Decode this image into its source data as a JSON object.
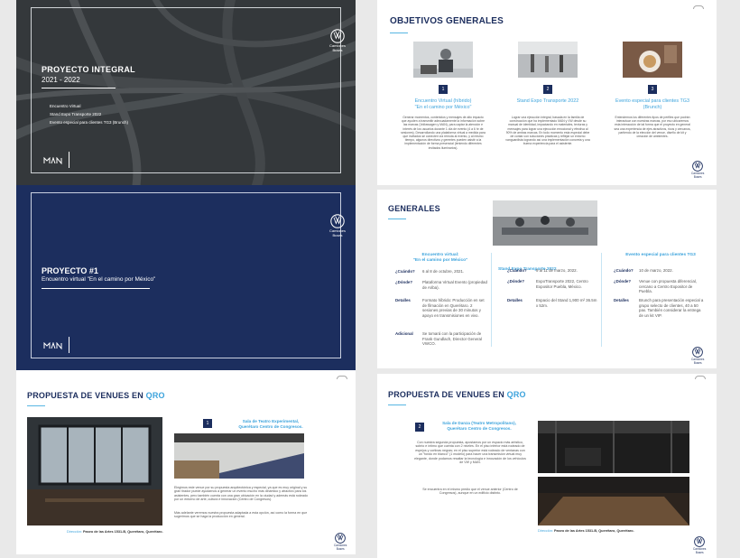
{
  "slide1": {
    "title": "PROYECTO INTEGRAL",
    "years": "2021 - 2022",
    "items": [
      "Encuentro Virtual",
      "Stand Expo Transporte 2022",
      "Evento especial para clientes TG3 (Brunch)"
    ],
    "brand": [
      "Camiones",
      "Buses"
    ]
  },
  "slide2": {
    "title": "OBJETIVOS GENERALES",
    "columns": [
      {
        "num": "1",
        "heading": "Encuentro Virtual (híbrido)\n\"En el camino por México\"",
        "text": "Generar momentos, contenidos y mensajes de alto impacto que ayuden a transmitir adecuadamente la información sobre las marcas (Volkswagen y MAN), para captar la atención e interés de los usuarios durante 1 día de evento (4 a 6 hr de sesiones). Desarrollando una plataforma virtual a medida para que invitados se conecten vía remota al evento, y al mismo tiempo, algunos directivos y gerentes pueden asistir a la implementación de forma presencial (teniendo diferentes invitados iluminarios)."
      },
      {
        "num": "2",
        "heading": "Stand Expo Transporte 2022",
        "text": "Lograr una ejecución integral, basada en la familia de construcción que ha implementado MAN y VW desde su manual de identidad, impactando en materiales, texturas y mensajes para lograr una ejecución emocional y efectiva al 90% de ambas marcas. En todo momento esta especial debe de contar con soluciones prácticas y reflejar un entorno vanguardista logrando así una implementación concreta y una buena experiencia para el asistente."
      },
      {
        "num": "3",
        "heading": "Evento especial para clientes TG3 (Brunch)",
        "text": "Entendemos los diferentes tipos de perfiles que podrán interactuar con nuestras marcas, por eso ubicaremos esta interacción de tal forma que el proyecto en general sea una experiencia de ejes atractivos, ricos y cercanos, partiendo de la elección del venue, diseño de kit y creación de ambientes."
      }
    ],
    "brand": [
      "Camiones",
      "Buses"
    ]
  },
  "slide3": {
    "title": "PROYECTO #1",
    "subtitle": "Encuentro virtual \"En el camino por México\"",
    "brand": [
      "Camiones",
      "Buses"
    ]
  },
  "slide4": {
    "title": "GENERALES",
    "col1": {
      "heading": "Encuentro virtual:\n\"En el camino por México\"",
      "rows": [
        {
          "label": "¿Cuándo?",
          "value": "6 al 8 de octubre, 2021."
        },
        {
          "label": "¿Dónde?",
          "value": "Plataforma Virtual Evento (propiedad de Ariba)."
        },
        {
          "label": "Detalles",
          "value": "Formato híbrido: Producción en set de filmación en Querétaro. 2 sesiones previas de 30 minutos y apoyo en transmisiones en vivo."
        },
        {
          "label": "Adicional",
          "value": "Se tomará con la participación de Frank Gundlach, Director General VWCO."
        }
      ]
    },
    "col2": {
      "heading": "Stand Expo Transporte 2022",
      "rows": [
        {
          "label": "¿Cuándo?",
          "value": "9 al 11 de marzo, 2022."
        },
        {
          "label": "¿Dónde?",
          "value": "ExpoTransporte 2022, Centro Expositor Puebla, México."
        },
        {
          "label": "Detalles",
          "value": "Espacio del Stand 1,900 m² 36.5m x 52m."
        }
      ]
    },
    "col3": {
      "heading": "Evento especial para clientes TG3",
      "rows": [
        {
          "label": "¿Cuándo?",
          "value": "10 de marzo, 2022."
        },
        {
          "label": "¿Dónde?",
          "value": "Venue con propuesta diferencial, cercano a Centro Expositor de Puebla."
        },
        {
          "label": "Detalles",
          "value": "Brunch para presentación especial a grupo selecto de clientes, 40 a 50 pax. También considerar la entrega de un kit VIP."
        }
      ]
    },
    "brand": [
      "Camiones",
      "Buses"
    ]
  },
  "slide5": {
    "title_main": "PROPUESTA DE VENUES EN ",
    "title_accent": "QRO",
    "num": "1",
    "heading": "Sala de Teatro Experimental,\nQuerétaro Centro de Congresos.",
    "text1": "Elegimos este venue por su propuesta arquitectónica y especial, ya que es muy original y su gran tirador puede ayudarnos a generar un evento mucho más dinámico y atractivo para los asistentes, pero también cuenta con una gran ubicación en la ciudad y además está rodeado por un entorno de arte, cultura e innovación (Centro de Congresos).",
    "text2": "Más adelante veremos nuestra propuesta adaptada a esta opción, así como la forma en que sugerimos que se haga la producción en general.",
    "address_label": "Dirección:",
    "address": "Paseo de las Artes 1531-B, Querétaro, Querétaro.",
    "brand": [
      "Camiones",
      "Buses"
    ]
  },
  "slide6": {
    "title_main": "PROPUESTA DE VENUES EN ",
    "title_accent": "QRO",
    "num": "2",
    "heading": "Sala de Danza (Teatro Metropolitano),\nQuerétaro Centro de Congresos.",
    "text1": "Con nuestra segunda propuesta, apostamos por un espacio más artístico, sobrio e íntimo que cuenta con 2 niveles. En el piso inferior está rodeado de espejos y cortinas negras; en el piso superior está rodeado de ventanas con un \"fondo en blanco\" (1 modelo) para hacer una transmisión virtual muy elegante, donde podamos resaltar la tecnología e innovación de los vehículos de VW y MAN.",
    "text2": "Se encuentra en el mismo predio que el venue anterior (Centro de Congresos), aunque en un edificio distinto.",
    "address_label": "Dirección:",
    "address": "Paseo de las Artes 1531-B, Querétaro, Querétaro.",
    "brand": [
      "Camiones",
      "Buses"
    ]
  },
  "colors": {
    "navy": "#1c2e5e",
    "accent": "#3ca3dc",
    "dark": "#2a2d30"
  }
}
